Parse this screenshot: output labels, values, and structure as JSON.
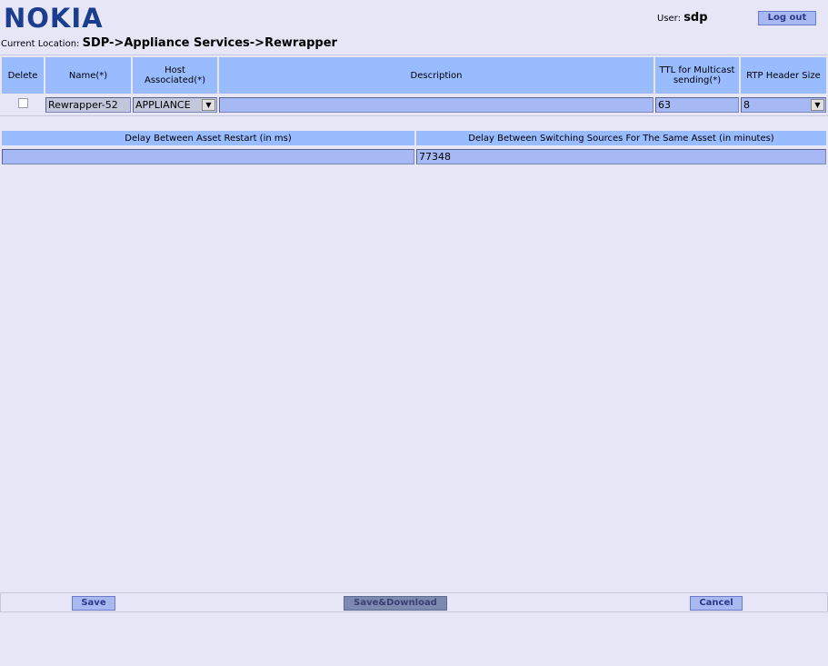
{
  "header": {
    "logo": "NOKIA",
    "user_label": "User:",
    "user_name": "sdp",
    "logout_label": "Log out"
  },
  "location": {
    "label": "Current Location:",
    "path": "SDP->Appliance Services->Rewrapper"
  },
  "main_table": {
    "headers": {
      "delete": "Delete",
      "name": "Name(*)",
      "host": "Host Associated(*)",
      "description": "Description",
      "ttl": "TTL for Multicast sending(*)",
      "rtp": "RTP Header Size"
    },
    "row": {
      "delete_checked": false,
      "name": "Rewrapper-52",
      "host": "APPLIANCE",
      "description": "",
      "ttl": "63",
      "rtp": "8"
    }
  },
  "delay_table": {
    "headers": {
      "restart": "Delay Between Asset Restart (in ms)",
      "switching": "Delay Between Switching Sources For The Same Asset (in minutes)"
    },
    "values": {
      "restart": "",
      "switching": "77348"
    }
  },
  "footer": {
    "save": "Save",
    "save_download": "Save&Download",
    "cancel": "Cancel"
  }
}
